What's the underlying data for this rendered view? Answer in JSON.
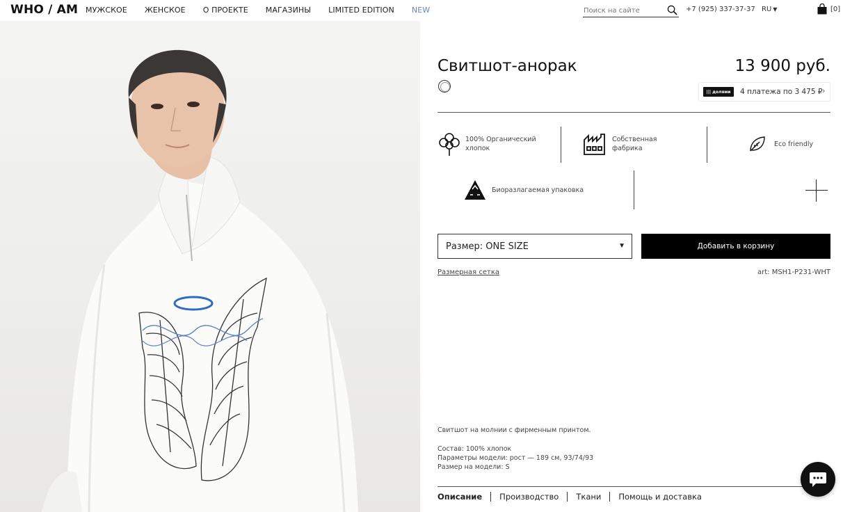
{
  "header": {
    "logo": "WHO / AM",
    "nav": [
      {
        "label": "МУЖСКОЕ"
      },
      {
        "label": "ЖЕНСКОЕ"
      },
      {
        "label": "О ПРОЕКТЕ"
      },
      {
        "label": "МАГАЗИНЫ"
      },
      {
        "label": "LIMITED EDITION"
      },
      {
        "label": "NEW"
      }
    ],
    "search_placeholder": "Поиск на сайте",
    "phone": "+7 (925) 337-37-37",
    "language": "RU",
    "cart_count": "[0]"
  },
  "product": {
    "title": "Свитшот-анорак",
    "price": "13 900 руб.",
    "dolyami": {
      "badge": "||| долями",
      "text": "4 платежа по 3 475 ₽"
    },
    "features": [
      {
        "icon": "cotton-icon",
        "label_line1": "100% Органический",
        "label_line2": "хлопок"
      },
      {
        "icon": "factory-icon",
        "label_line1": "Собственная",
        "label_line2": "фабрика"
      },
      {
        "icon": "leaf-icon",
        "label_line1": "Eco friendly",
        "label_line2": ""
      },
      {
        "icon": "recycle-box-icon",
        "label_line1": "Биоразлагаемая упаковка",
        "label_line2": ""
      }
    ],
    "size_label": "Размер: ONE SIZE",
    "add_to_cart": "Добавить в корзину",
    "size_chart_link": "Размерная сетка",
    "article": "art: MSH1-P231-WHT",
    "description": {
      "lead": "Свитшот на молнии с фирменным принтом.",
      "composition": "Состав: 100% хлопок",
      "model_params": "Параметры модели: рост — 189 см, 93/74/93",
      "model_size": "Размер на модели: S"
    }
  },
  "tabs": [
    {
      "label": "Описание",
      "active": true
    },
    {
      "label": "Производство",
      "active": false
    },
    {
      "label": "Ткани",
      "active": false
    },
    {
      "label": "Помощь и доставка",
      "active": false
    }
  ],
  "colors": {
    "accent_new": "#6a86c9",
    "button_bg": "#000000",
    "text": "#111111"
  }
}
